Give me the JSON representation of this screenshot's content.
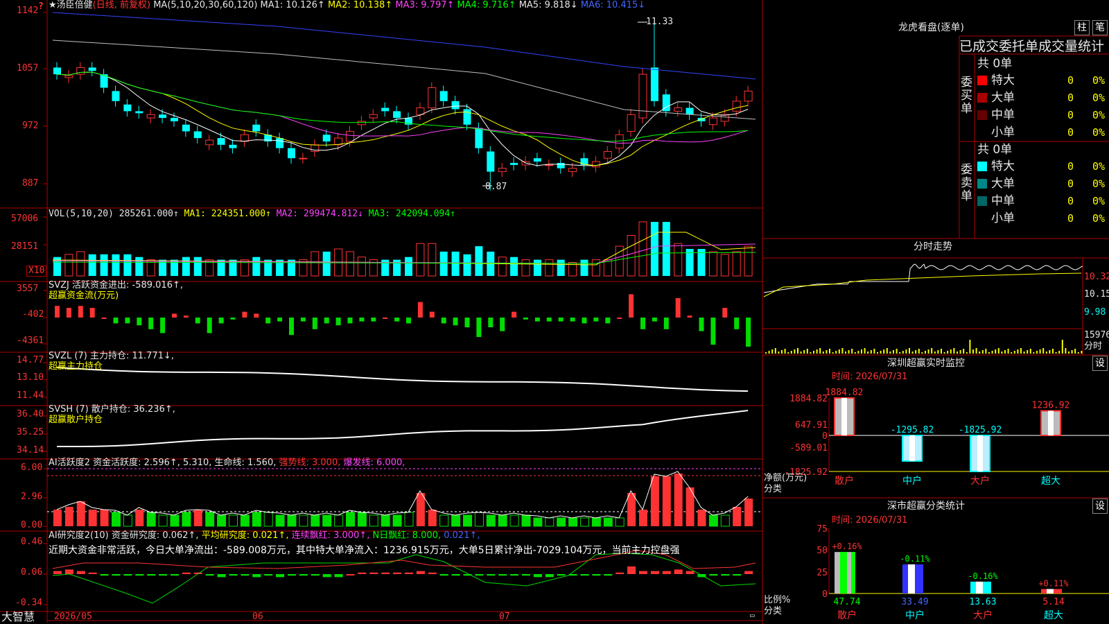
{
  "kline": {
    "title": "★汤臣倍健",
    "period": "(日线, 前复权)",
    "ma_label": "MA(5,10,20,30,60,120)",
    "ma1": "MA1: 10.126↑",
    "ma2": "MA2: 10.138↑",
    "ma3": "MA3: 9.797↑",
    "ma4": "MA4: 9.716↑",
    "ma5": "MA5: 9.818↓",
    "ma6": "MA6: 10.415↓",
    "y_ticks": [
      "1142",
      "1057",
      "972",
      "887"
    ],
    "high_label": "11.33",
    "low_label": "8.87"
  },
  "vol": {
    "label": "VOL(5,10,20) 285261.000↑",
    "ma1": "MA1: 224351.000↑",
    "ma2": "MA2: 299474.812↓",
    "ma3": "MA3: 242094.094↑",
    "y_ticks": [
      "57006",
      "28151"
    ],
    "unit": "X10"
  },
  "svzj": {
    "label": "SVZJ  活跃资金进出: -589.016↑,",
    "sub": "超赢资金流(万元)",
    "y_ticks": [
      "3557",
      "-402",
      "-4361"
    ]
  },
  "svzl": {
    "label": "SVZL (7) 主力持仓: 11.771↓,",
    "sub": "超赢主力持仓",
    "y_ticks": [
      "14.77",
      "13.10",
      "11.44"
    ]
  },
  "svsh": {
    "label": "SVSH (7) 散户持仓: 36.236↑,",
    "sub": "超赢散户持仓",
    "y_ticks": [
      "36.40",
      "35.25",
      "34.14"
    ]
  },
  "ai1": {
    "label": "AI活跃度2 资金活跃度: 2.596↑, 5.310, 生命线: 1.560, ",
    "strong": "强势线: 3.000,",
    "burst": "爆发线: 6.000,",
    "y_ticks": [
      "6.00",
      "2.96",
      "0.00"
    ]
  },
  "ai2": {
    "label": "AI研究度2(10) 资金研究度: 0.062↑, ",
    "avg": "平均研究度: 0.021↑,",
    "red": "连续飘红: 3.000↑,",
    "nred": "N日飘红: 8.000,",
    "last": "0.021↑,",
    "y_ticks": [
      "0.46",
      "0.06",
      "-0.34"
    ],
    "note": "近期大资金非常活跃，今日大单净流出：-589.008万元，其中特大单净流入：1236.915万元，大单5日累计净出-7029.104万元，当前主力控盘强"
  },
  "x_axis": {
    "brand": "大智慧",
    "labels": [
      "2026/05",
      "06",
      "07"
    ]
  },
  "lhb": {
    "title": "龙虎看盘(逐单)",
    "btn_bar": "柱",
    "btn_line": "笔",
    "stat_title": "已成交委托单成交量统计",
    "buy_label": "委买单",
    "sell_label": "委卖单",
    "buy_total": "共 0单",
    "sell_total": "共 0单",
    "buy_rows": [
      {
        "name": "特大",
        "count": "0",
        "pct": "0%",
        "color": "#ff0000"
      },
      {
        "name": "大单",
        "count": "0",
        "pct": "0%",
        "color": "#aa0000"
      },
      {
        "name": "中单",
        "count": "0",
        "pct": "0%",
        "color": "#660000"
      },
      {
        "name": "小单",
        "count": "0",
        "pct": "0%",
        "color": "#000000"
      }
    ],
    "sell_rows": [
      {
        "name": "特大",
        "count": "0",
        "pct": "0%",
        "color": "#00ffff"
      },
      {
        "name": "大单",
        "count": "0",
        "pct": "0%",
        "color": "#008888"
      },
      {
        "name": "中单",
        "count": "0",
        "pct": "0%",
        "color": "#006666"
      },
      {
        "name": "小单",
        "count": "0",
        "pct": "0%",
        "color": "#000000"
      }
    ]
  },
  "intraday": {
    "title": "分时走势",
    "y_ticks": [
      "10.32",
      "10.15",
      "9.98"
    ],
    "vol_tick": "15976",
    "vol_unit": "分时"
  },
  "monitor": {
    "title": "深圳超赢实时监控",
    "btn": "设",
    "time": "时间: 2026/07/31",
    "y_ticks": [
      "1884.82",
      "647.91",
      "0",
      "-589.01",
      "-1825.92"
    ],
    "ylabel": "净额(万元)",
    "xlabel": "分类",
    "categories": [
      "散户",
      "中户",
      "大户",
      "超大"
    ],
    "values": [
      1884.82,
      -1295.82,
      -1825.92,
      1236.92
    ],
    "value_labels": [
      "1884.82",
      "-1295.82",
      "-1825.92",
      "1236.92"
    ]
  },
  "classstat": {
    "title": "深市超赢分类统计",
    "btn": "设",
    "time": "时间: 2026/07/31",
    "y_ticks": [
      "75",
      "50",
      "25",
      "0"
    ],
    "ylabel": "比例%",
    "xlabel": "分类",
    "categories": [
      "散户",
      "中户",
      "大户",
      "超大"
    ],
    "values": [
      47.74,
      33.49,
      13.63,
      5.14
    ],
    "value_labels": [
      "47.74",
      "33.49",
      "13.63",
      "5.14"
    ],
    "change_labels": [
      "+0.16%",
      "-0.11%",
      "-0.16%",
      "+0.11%"
    ]
  },
  "chart_data": {
    "type": "bar",
    "title": "深圳超赢实时监控",
    "categories": [
      "散户",
      "中户",
      "大户",
      "超大"
    ],
    "series": [
      {
        "name": "净额(万元)",
        "values": [
          1884.82,
          -1295.82,
          -1825.92,
          1236.92
        ]
      },
      {
        "name": "比例%",
        "values": [
          47.74,
          33.49,
          13.63,
          5.14
        ]
      }
    ],
    "xlabel": "分类",
    "ylabel": "净额(万元)",
    "ylim": [
      -1825.92,
      1884.82
    ]
  },
  "colors": {
    "up": "#ff3333",
    "down": "#00ffff",
    "grid": "#b00000",
    "ma1": "#ffffff",
    "ma2": "#ffff00",
    "ma3": "#ff44ff",
    "ma4": "#00ff00",
    "ma5": "#c0c0c0",
    "ma6": "#3344ff"
  }
}
